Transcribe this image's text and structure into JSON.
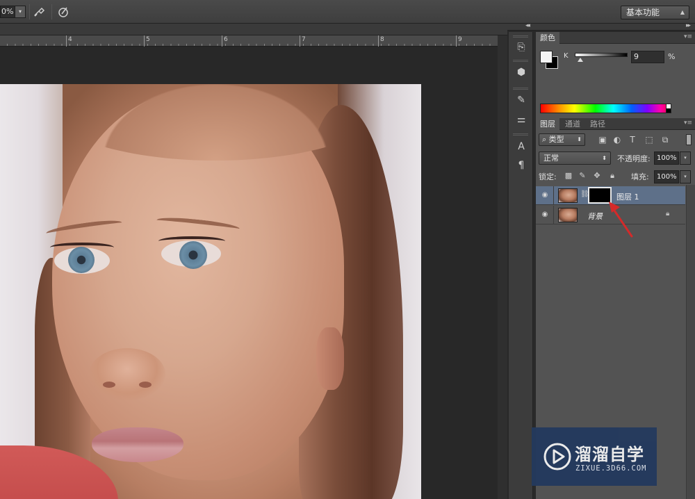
{
  "options_bar": {
    "zoom_value": "0%",
    "workspace_label": "基本功能"
  },
  "ruler": {
    "marks": [
      {
        "label": "4",
        "pos": 95
      },
      {
        "label": "5",
        "pos": 207
      },
      {
        "label": "6",
        "pos": 319
      },
      {
        "label": "7",
        "pos": 431
      },
      {
        "label": "8",
        "pos": 544
      },
      {
        "label": "9",
        "pos": 656
      }
    ]
  },
  "color_panel": {
    "tab": "颜色",
    "channel_label": "K",
    "channel_value": "9",
    "percent_sign": "%",
    "foreground_color": "#f4f4f4",
    "background_color": "#000000"
  },
  "layers_panel": {
    "tabs": [
      "图层",
      "通道",
      "路径"
    ],
    "filter_type": "类型",
    "blend_mode": "正常",
    "opacity_label": "不透明度:",
    "opacity_value": "100%",
    "lock_label": "锁定:",
    "fill_label": "填充:",
    "fill_value": "100%",
    "layers": [
      {
        "name": "图层 1",
        "selected": true,
        "has_mask": true
      },
      {
        "name": "背景",
        "selected": false,
        "locked": true
      }
    ]
  },
  "watermark": {
    "name": "溜溜自学",
    "url": "ZIXUE.3D66.COM"
  },
  "colors": {
    "selection_blue": "#5e7089",
    "annotation_red": "#d42a2a",
    "watermark_bg": "#243a5e"
  }
}
